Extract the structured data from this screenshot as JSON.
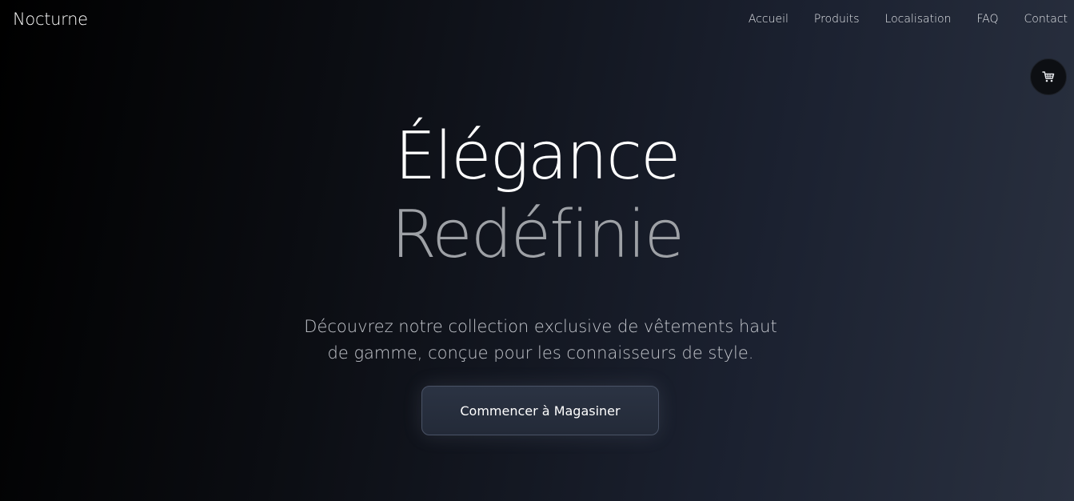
{
  "brand": {
    "name": "Nocturne"
  },
  "nav": {
    "items": [
      {
        "label": "Accueil"
      },
      {
        "label": "Produits"
      },
      {
        "label": "Localisation"
      },
      {
        "label": "FAQ"
      },
      {
        "label": "Contact"
      }
    ]
  },
  "cart": {
    "icon": "shopping-cart-icon"
  },
  "hero": {
    "title_line1": "Élégance",
    "title_line2": "Redéfinie",
    "subtitle": "Découvrez notre collection exclusive de vêtements haut de gamme, conçue pour les connaisseurs de style.",
    "cta_label": "Commencer à Magasiner"
  },
  "colors": {
    "background_start": "#000000",
    "background_end": "#2a3140",
    "title_primary": "#ffffff",
    "title_secondary": "#9ea1a6",
    "cta_background": "#2b3343",
    "cta_border": "#4a5366"
  }
}
